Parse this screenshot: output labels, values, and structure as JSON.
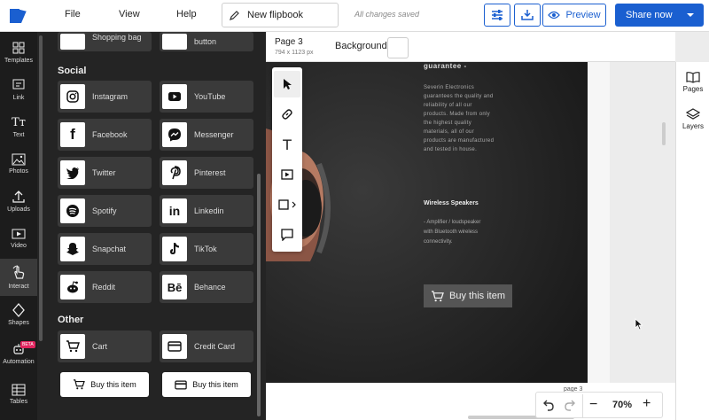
{
  "header": {
    "menu": [
      "File",
      "View",
      "Help"
    ],
    "doc_title": "New flipbook",
    "save_status": "All changes saved",
    "preview_label": "Preview",
    "share_label": "Share now",
    "accent_color": "#1a5fd0"
  },
  "rail": {
    "items": [
      "Templates",
      "Link",
      "Text",
      "Photos",
      "Uploads",
      "Video",
      "Interact",
      "Shapes",
      "Automation",
      "Tables"
    ],
    "active": "Interact",
    "beta_label": "BETA"
  },
  "panel": {
    "top_partial": [
      "Shopping bag",
      "button"
    ],
    "social_heading": "Social",
    "social": [
      "Instagram",
      "YouTube",
      "Facebook",
      "Messenger",
      "Twitter",
      "Pinterest",
      "Spotify",
      "Linkedin",
      "Snapchat",
      "TikTok",
      "Reddit",
      "Behance"
    ],
    "other_heading": "Other",
    "other": [
      "Cart",
      "Credit Card"
    ],
    "buttons": [
      "Buy this item",
      "Buy this item"
    ]
  },
  "canvas": {
    "page_name": "Page 3",
    "page_size": "794 x 1123 px",
    "background_label": "Background",
    "guarantee_title": "guarantee -",
    "guarantee_text": "Severin Electronics guarantees the quality and reliability of all our products. Made from only the highest quality materials, all of our products are manufactured and tested in house.",
    "speaker_title": "Wireless Speakers",
    "speaker_text": "- Amplifier / loudspeaker with Bluetooth wireless connectivity.",
    "buy_button": "Buy this item",
    "page_footer": "page 3"
  },
  "zoom": {
    "value": "70%"
  },
  "right_rail": [
    "Pages",
    "Layers"
  ]
}
